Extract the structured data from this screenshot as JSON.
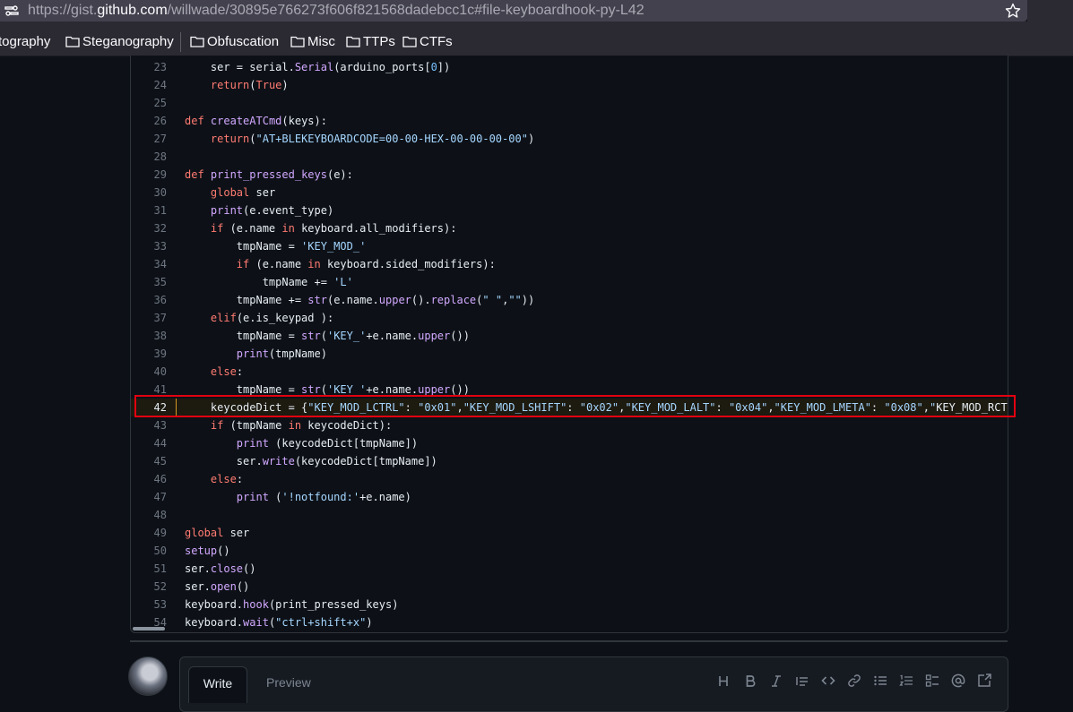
{
  "browser": {
    "url_prefix": "https://gist.",
    "url_domain": "github.com",
    "url_path": "/willwade/30895e766273f606f821568dadebcc1c#file-keyboardhook-py-L42",
    "icons": [
      "site-info-icon",
      "bookmark-star-icon"
    ]
  },
  "bookmarks": [
    {
      "label": "tography",
      "folder": false
    },
    {
      "label": "Steganography",
      "folder": true
    },
    {
      "label": "Obfuscation",
      "folder": true
    },
    {
      "label": "Misc",
      "folder": true
    },
    {
      "label": "TTPs",
      "folder": true
    },
    {
      "label": "CTFs",
      "folder": true
    }
  ],
  "code": {
    "highlighted_line": 42,
    "lines": [
      {
        "n": "23",
        "t": "    ser = serial.Serial(arduino_ports[0])"
      },
      {
        "n": "24",
        "t": "    return(True)"
      },
      {
        "n": "25",
        "t": ""
      },
      {
        "n": "26",
        "t": "def createATCmd(keys):"
      },
      {
        "n": "27",
        "t": "    return(\"AT+BLEKEYBOARDCODE=00-00-HEX-00-00-00-00\")"
      },
      {
        "n": "28",
        "t": ""
      },
      {
        "n": "29",
        "t": "def print_pressed_keys(e):"
      },
      {
        "n": "30",
        "t": "    global ser"
      },
      {
        "n": "31",
        "t": "    print(e.event_type)"
      },
      {
        "n": "32",
        "t": "    if (e.name in keyboard.all_modifiers):"
      },
      {
        "n": "33",
        "t": "        tmpName = 'KEY_MOD_'"
      },
      {
        "n": "34",
        "t": "        if (e.name in keyboard.sided_modifiers):"
      },
      {
        "n": "35",
        "t": "            tmpName += 'L'"
      },
      {
        "n": "36",
        "t": "        tmpName += str(e.name.upper().replace(\" \",\"\"))"
      },
      {
        "n": "37",
        "t": "    elif(e.is_keypad ):"
      },
      {
        "n": "38",
        "t": "        tmpName = str('KEY_'+e.name.upper())"
      },
      {
        "n": "39",
        "t": "        print(tmpName)"
      },
      {
        "n": "40",
        "t": "    else:"
      },
      {
        "n": "41",
        "t": "        tmpName = str('KEY_'+e.name.upper())"
      },
      {
        "n": "42",
        "t": "    keycodeDict = {\"KEY_MOD_LCTRL\": \"0x01\",\"KEY_MOD_LSHIFT\": \"0x02\",\"KEY_MOD_LALT\": \"0x04\",\"KEY_MOD_LMETA\": \"0x08\",\"KEY_MOD_RCTR"
      },
      {
        "n": "43",
        "t": "    if (tmpName in keycodeDict):"
      },
      {
        "n": "44",
        "t": "        print (keycodeDict[tmpName])"
      },
      {
        "n": "45",
        "t": "        ser.write(keycodeDict[tmpName])"
      },
      {
        "n": "46",
        "t": "    else:"
      },
      {
        "n": "47",
        "t": "        print ('!notfound:'+e.name)"
      },
      {
        "n": "48",
        "t": ""
      },
      {
        "n": "49",
        "t": "global ser"
      },
      {
        "n": "50",
        "t": "setup()"
      },
      {
        "n": "51",
        "t": "ser.close()"
      },
      {
        "n": "52",
        "t": "ser.open()"
      },
      {
        "n": "53",
        "t": "keyboard.hook(print_pressed_keys)"
      },
      {
        "n": "54",
        "t": "keyboard.wait(\"ctrl+shift+x\")"
      }
    ]
  },
  "comment": {
    "write_tab": "Write",
    "preview_tab": "Preview",
    "toolbar_icons": [
      "heading-icon",
      "bold-icon",
      "italic-icon",
      "quote-icon",
      "code-icon",
      "link-icon",
      "unordered-list-icon",
      "ordered-list-icon",
      "task-list-icon",
      "mention-icon",
      "reference-icon"
    ]
  },
  "colors": {
    "keyword": "#ff7b72",
    "function": "#d2a8ff",
    "string": "#a5d6ff",
    "number": "#79c0ff",
    "highlight_box": "#e3000f"
  }
}
